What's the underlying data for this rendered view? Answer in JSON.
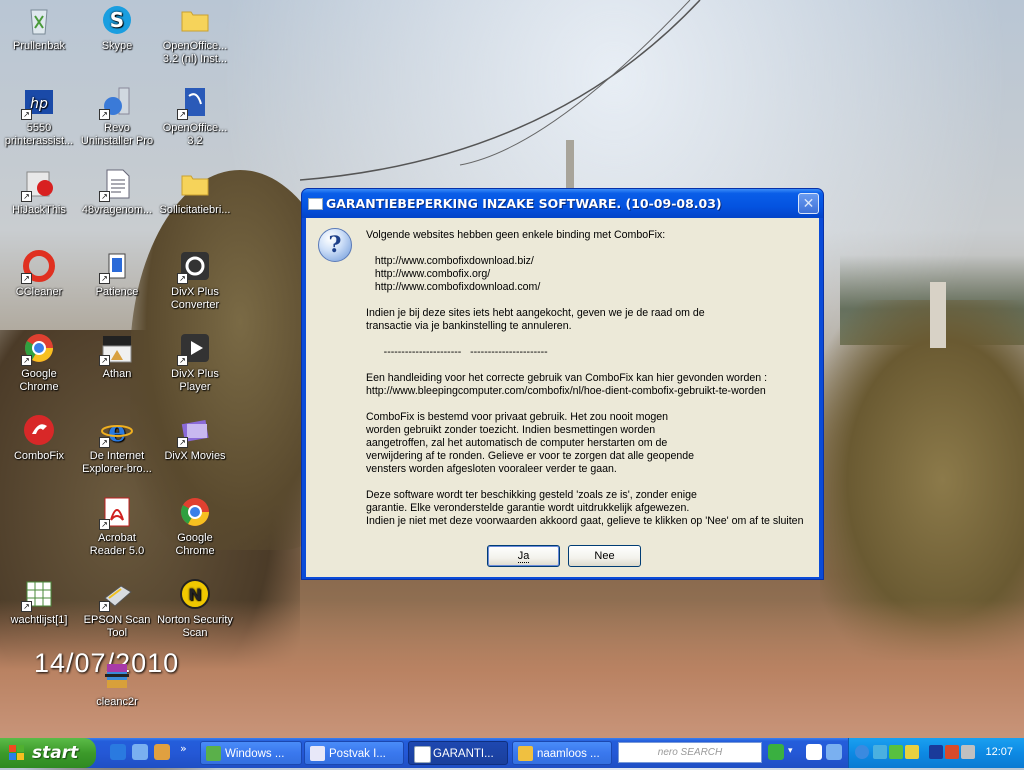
{
  "desktop": {
    "icons": [
      {
        "label": "Prullenbak"
      },
      {
        "label": "Skype"
      },
      {
        "label": "OpenOffice... 3.2 (nl) Inst..."
      },
      {
        "label": "5550 printerassist..."
      },
      {
        "label": "Revo Uninstaller Pro"
      },
      {
        "label": "OpenOffice... 3.2"
      },
      {
        "label": "HiJackThis"
      },
      {
        "label": "48vragenom..."
      },
      {
        "label": "Sollicitatiebri..."
      },
      {
        "label": "CCleaner"
      },
      {
        "label": "Patience"
      },
      {
        "label": "DivX Plus Converter"
      },
      {
        "label": "Google Chrome"
      },
      {
        "label": "Athan"
      },
      {
        "label": "DivX Plus Player"
      },
      {
        "label": "ComboFix"
      },
      {
        "label": "De Internet Explorer-bro..."
      },
      {
        "label": "DivX Movies"
      },
      {
        "label": "Acrobat Reader 5.0"
      },
      {
        "label": "Google Chrome"
      },
      {
        "label": "wachtlijst[1]"
      },
      {
        "label": "EPSON Scan Tool"
      },
      {
        "label": "Norton Security Scan"
      },
      {
        "label": "cleanc2r"
      }
    ],
    "date_overlay": "14/07/2010"
  },
  "dialog": {
    "title": "GARANTIEBEPERKING INZAKE SOFTWARE. (10-09-08.03)",
    "close_label": "✕",
    "message": "Volgende websites hebben geen enkele binding met ComboFix:\n\n   http://www.combofixdownload.biz/\n   http://www.combofix.org/\n   http://www.combofixdownload.com/\n\nIndien je bij deze sites iets hebt aangekocht, geven we je de raad om de\ntransactie via je bankinstelling te annuleren.\n\n      ----------------------   ----------------------\n\nEen handleiding voor het correcte gebruik van ComboFix kan hier gevonden worden :\nhttp://www.bleepingcomputer.com/combofix/nl/hoe-dient-combofix-gebruikt-te-worden\n\nComboFix is bestemd voor privaat gebruik. Het zou nooit mogen\nworden gebruikt zonder toezicht. Indien besmettingen worden\naangetroffen, zal het automatisch de computer herstarten om de\nverwijdering af te ronden. Gelieve er voor te zorgen dat alle geopende\nvensters worden afgesloten vooraleer verder te gaan.\n\nDeze software wordt ter beschikking gesteld 'zoals ze is', zonder enige\ngarantie. Elke veronderstelde garantie wordt uitdrukkelijk afgewezen.\nIndien je niet met deze voorwaarden akkoord gaat, gelieve te klikken op 'Nee' om af te sluiten",
    "buttons": {
      "yes": "Ja",
      "no": "Nee"
    }
  },
  "taskbar": {
    "start_label": "start",
    "tasks": [
      {
        "label": "Windows ..."
      },
      {
        "label": "Postvak I..."
      },
      {
        "label": "GARANTI..."
      },
      {
        "label": "naamloos ..."
      }
    ],
    "search_label": "nero SEARCH",
    "clock": "12:07"
  },
  "colors": {
    "taskbar_blue": "#245edb",
    "start_green": "#3c9a2a",
    "dialog_face": "#ece9d8",
    "title_blue": "#0453e0"
  }
}
